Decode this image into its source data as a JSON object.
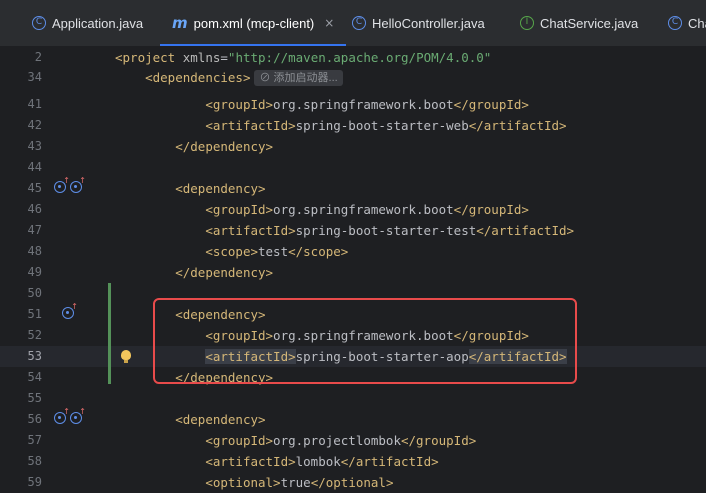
{
  "tabs": [
    {
      "label": "Application.java",
      "icon": "java-class-icon",
      "active": false
    },
    {
      "label": "pom.xml (mcp-client)",
      "icon": "maven-icon",
      "active": true
    },
    {
      "label": "HelloController.java",
      "icon": "java-class-icon",
      "active": false
    },
    {
      "label": "ChatService.java",
      "icon": "java-interface-icon",
      "active": false
    },
    {
      "label": "Cha",
      "icon": "java-class-icon",
      "active": false
    }
  ],
  "icons": {
    "class_glyph": "C",
    "interface_glyph": "I",
    "maven_glyph": "m",
    "close_glyph": "×"
  },
  "hint": "添加启动器...",
  "lines": [
    {
      "n": "2",
      "html": "<span class='tag'>&lt;project</span> <span class='attr'>xmlns</span><span class='txt'>=</span><span class='str'>\"http://maven.apache.org/POM/4.0.0\"</span>"
    },
    {
      "n": "34",
      "html": "    <span class='tag'>&lt;dependencies&gt;</span>"
    },
    {
      "n": "41",
      "html": "            <span class='tag'>&lt;groupId&gt;</span>org.springframework.boot<span class='tag'>&lt;/groupId&gt;</span>"
    },
    {
      "n": "42",
      "html": "            <span class='tag'>&lt;artifactId&gt;</span>spring-boot-starter-web<span class='tag'>&lt;/artifactId&gt;</span>"
    },
    {
      "n": "43",
      "html": "        <span class='tag'>&lt;/dependency&gt;</span>"
    },
    {
      "n": "44",
      "html": ""
    },
    {
      "n": "45",
      "html": "        <span class='tag'>&lt;dependency&gt;</span>"
    },
    {
      "n": "46",
      "html": "            <span class='tag'>&lt;groupId&gt;</span>org.springframework.boot<span class='tag'>&lt;/groupId&gt;</span>"
    },
    {
      "n": "47",
      "html": "            <span class='tag'>&lt;artifactId&gt;</span>spring-boot-starter-test<span class='tag'>&lt;/artifactId&gt;</span>"
    },
    {
      "n": "48",
      "html": "            <span class='tag'>&lt;scope&gt;</span>test<span class='tag'>&lt;/scope&gt;</span>"
    },
    {
      "n": "49",
      "html": "        <span class='tag'>&lt;/dependency&gt;</span>"
    },
    {
      "n": "50",
      "html": ""
    },
    {
      "n": "51",
      "html": "        <span class='tag'>&lt;dependency&gt;</span>"
    },
    {
      "n": "52",
      "html": "            <span class='tag'>&lt;groupId&gt;</span>org.springframework.boot<span class='tag'>&lt;/groupId&gt;</span>"
    },
    {
      "n": "53",
      "html": "            <span class='hl'><span class='tag'>&lt;artifactId&gt;</span></span>spring-boot-starter-aop<span class='hl'><span class='tag'>&lt;/artifactId&gt;</span></span>"
    },
    {
      "n": "54",
      "html": "        <span class='tag'>&lt;/dependency&gt;</span>"
    },
    {
      "n": "55",
      "html": ""
    },
    {
      "n": "56",
      "html": "        <span class='tag'>&lt;dependency&gt;</span>"
    },
    {
      "n": "57",
      "html": "            <span class='tag'>&lt;groupId&gt;</span>org.projectlombok<span class='tag'>&lt;/groupId&gt;</span>"
    },
    {
      "n": "58",
      "html": "            <span class='tag'>&lt;artifactId&gt;</span>lombok<span class='tag'>&lt;/artifactId&gt;</span>"
    },
    {
      "n": "59",
      "html": "            <span class='tag'>&lt;optional&gt;</span>true<span class='tag'>&lt;/optional&gt;</span>"
    }
  ],
  "current_line": "53"
}
